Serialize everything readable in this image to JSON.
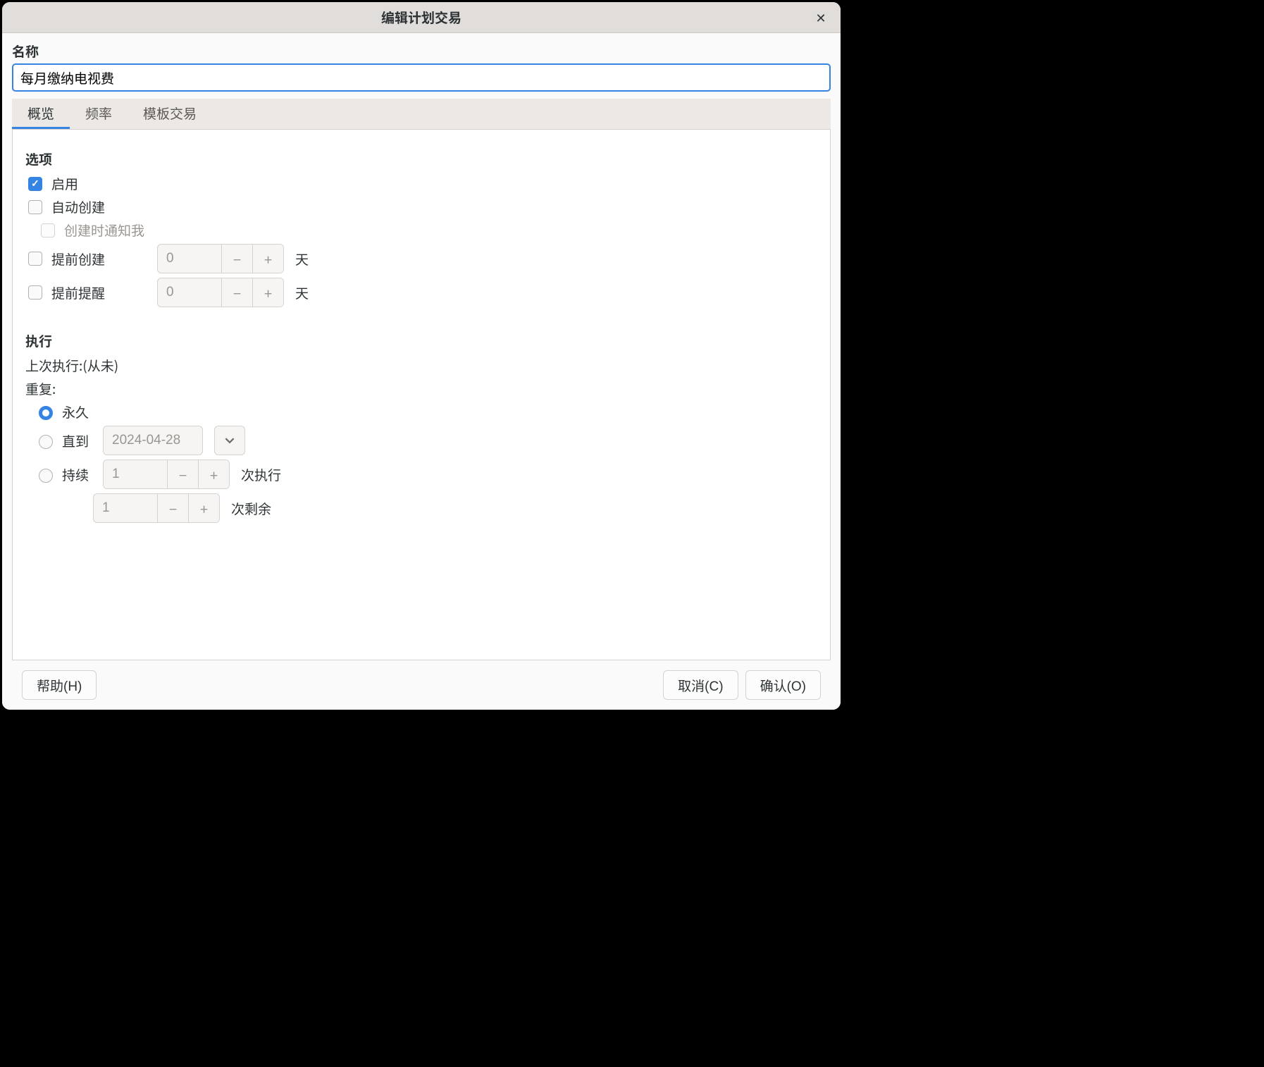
{
  "window": {
    "title": "编辑计划交易"
  },
  "name": {
    "label": "名称",
    "value": "每月缴纳电视费"
  },
  "tabs": [
    {
      "id": "overview",
      "label": "概览",
      "active": true
    },
    {
      "id": "frequency",
      "label": "频率",
      "active": false
    },
    {
      "id": "template",
      "label": "模板交易",
      "active": false
    }
  ],
  "options": {
    "section_title": "选项",
    "enable": {
      "label": "启用",
      "checked": true
    },
    "auto_create": {
      "label": "自动创建",
      "checked": false
    },
    "notify_on_create": {
      "label": "创建时通知我",
      "checked": false,
      "disabled": true
    },
    "create_ahead": {
      "label": "提前创建",
      "checked": false,
      "value": "0",
      "unit": "天"
    },
    "remind_ahead": {
      "label": "提前提醒",
      "checked": false,
      "value": "0",
      "unit": "天"
    }
  },
  "execution": {
    "section_title": "执行",
    "last_run_label": "上次执行:(从未)",
    "repeat_label": "重复:",
    "forever": {
      "label": "永久",
      "selected": true
    },
    "until": {
      "label": "直到",
      "selected": false,
      "date": "2024-04-28"
    },
    "for": {
      "label": "持续",
      "selected": false,
      "occurrences_value": "1",
      "occurrences_unit": "次执行",
      "remaining_value": "1",
      "remaining_unit": "次剩余"
    }
  },
  "footer": {
    "help": "帮助(H)",
    "cancel": "取消(C)",
    "ok": "确认(O)"
  }
}
